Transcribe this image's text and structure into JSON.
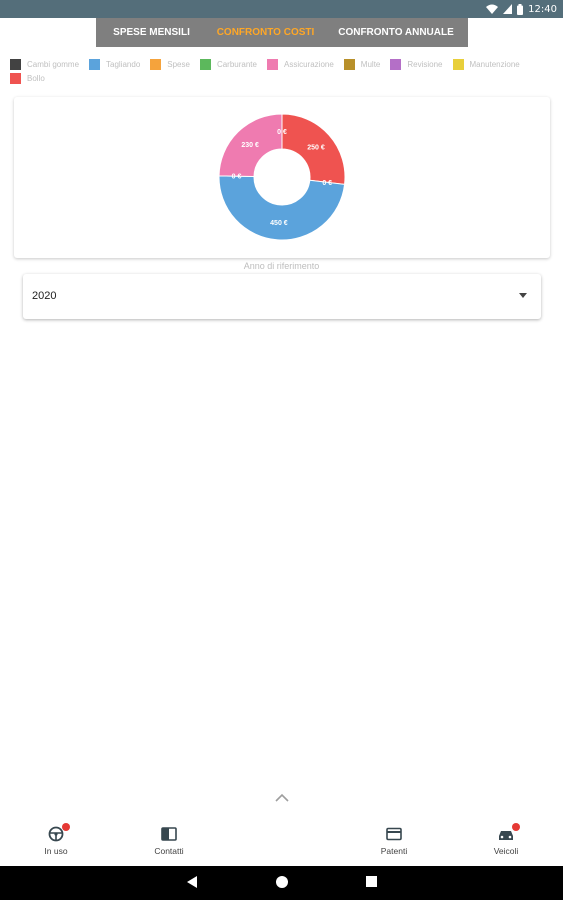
{
  "status_bar": {
    "time": "12:40",
    "icons": [
      "wifi-icon",
      "cell-signal-icon",
      "battery-icon"
    ]
  },
  "tabs": [
    {
      "label": "SPESE MENSILI",
      "active": false
    },
    {
      "label": "CONFRONTO COSTI",
      "active": true
    },
    {
      "label": "CONFRONTO ANNUALE",
      "active": false
    }
  ],
  "colors": {
    "tab_active": "#ffa726",
    "tab_bg": "#7f7f7f",
    "status_bar": "#546e7a"
  },
  "legend": [
    {
      "label": "Cambi gomme",
      "color": "#424242"
    },
    {
      "label": "Tagliando",
      "color": "#5ba3dc"
    },
    {
      "label": "Spese",
      "color": "#f5a33c"
    },
    {
      "label": "Carburante",
      "color": "#5cb85c"
    },
    {
      "label": "Assicurazione",
      "color": "#ef7bb0"
    },
    {
      "label": "Multe",
      "color": "#b8902a"
    },
    {
      "label": "Revisione",
      "color": "#b46fc7"
    },
    {
      "label": "Manutenzione",
      "color": "#e8cf3a"
    },
    {
      "label": "Bollo",
      "color": "#ef5350"
    }
  ],
  "chart_data": {
    "type": "pie",
    "donut": true,
    "categories": [
      "Bollo",
      "Revisione",
      "Tagliando",
      "Cambi gomme",
      "Assicurazione",
      "Multe"
    ],
    "values": [
      250,
      0,
      450,
      0,
      230,
      0
    ],
    "labels": [
      "250 €",
      "0 €",
      "450 €",
      "0 €",
      "230 €",
      "0 €"
    ],
    "colors": [
      "#ef5350",
      "#b46fc7",
      "#5ba3dc",
      "#424242",
      "#ef7bb0",
      "#b8902a"
    ],
    "title": "",
    "legend_position": "top"
  },
  "year_select": {
    "label": "Anno di riferimento",
    "value": "2020"
  },
  "bottom_nav": [
    {
      "label": "In uso",
      "icon": "steering-wheel-icon",
      "badge": true
    },
    {
      "label": "Contatti",
      "icon": "contacts-book-icon",
      "badge": false
    },
    {
      "label": "Patenti",
      "icon": "license-card-icon",
      "badge": false
    },
    {
      "label": "Veicoli",
      "icon": "car-icon",
      "badge": true
    }
  ],
  "system_nav": [
    "back-icon",
    "home-icon",
    "recents-icon"
  ]
}
